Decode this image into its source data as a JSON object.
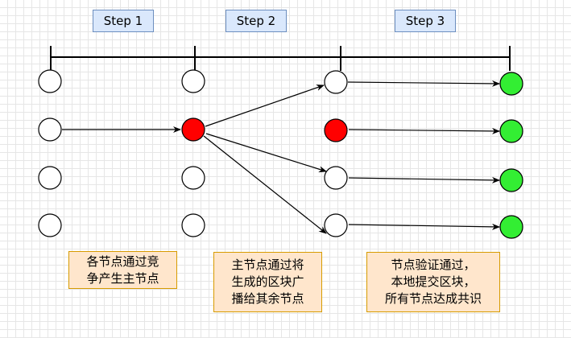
{
  "steps": {
    "step1": "Step 1",
    "step2": "Step 2",
    "step3": "Step 3"
  },
  "notes": {
    "note1": [
      "各节点通过竞",
      "争产生主节点"
    ],
    "note2": [
      "主节点通过将",
      "生成的区块广",
      "播给其余节点"
    ],
    "note3": [
      "节点验证通过，",
      "本地提交区块，",
      "所有节点达成共识"
    ]
  },
  "colors": {
    "leader_node": "#ff0000",
    "committed_node": "#33ee33",
    "idle_node": "#ffffff",
    "step_fill": "#dae8fc",
    "step_border": "#6c8ebf",
    "note_fill": "#ffe6cc",
    "note_border": "#d79b00"
  }
}
